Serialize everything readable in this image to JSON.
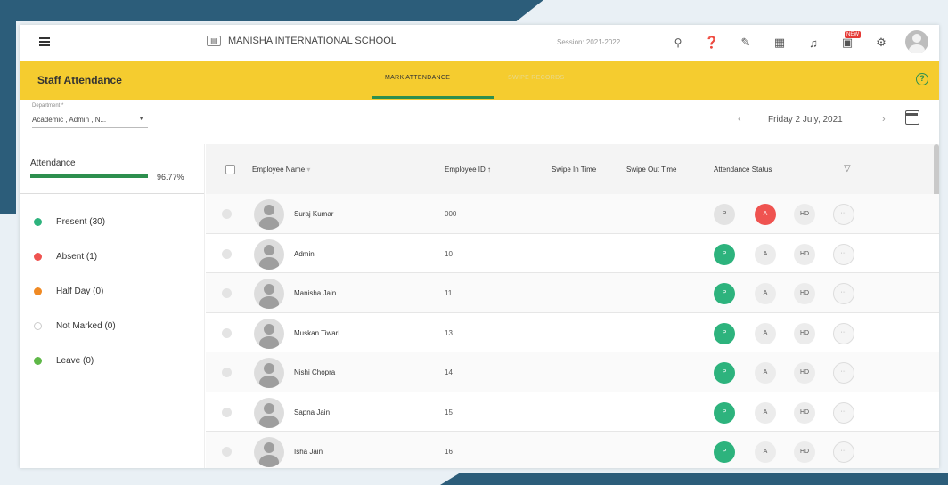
{
  "header": {
    "school_name": "MANISHA INTERNATIONAL SCHOOL",
    "session": "Session: 2021-2022",
    "new_badge": "NEW"
  },
  "page": {
    "title": "Staff Attendance",
    "tabs": [
      {
        "label": "MARK ATTENDANCE",
        "active": true
      },
      {
        "label": "SWIPE RECORDS",
        "active": false
      }
    ]
  },
  "filters": {
    "department_label": "Department *",
    "department_value": "Academic , Admin , N...",
    "date": "Friday 2 July, 2021"
  },
  "summary": {
    "attendance_label": "Attendance",
    "attendance_pct": "96.77%",
    "attendance_fraction": 0.9677,
    "legend": [
      {
        "label": "Present (30)",
        "color": "#2db37d"
      },
      {
        "label": "Absent (1)",
        "color": "#ef5350"
      },
      {
        "label": "Half Day (0)",
        "color": "#f08a24"
      },
      {
        "label": "Not Marked (0)",
        "color": "hollow"
      },
      {
        "label": "Leave (0)",
        "color": "#5fb848"
      }
    ]
  },
  "table": {
    "columns": {
      "name": "Employee Name",
      "id": "Employee ID",
      "swipe_in": "Swipe In Time",
      "swipe_out": "Swipe Out Time",
      "status": "Attendance Status"
    },
    "status_labels": {
      "present": "P",
      "absent": "A",
      "half_day": "HD",
      "more": "···"
    },
    "rows": [
      {
        "name": "Suraj Kumar",
        "id": "000",
        "status": "absent"
      },
      {
        "name": "Admin",
        "id": "10",
        "status": "present"
      },
      {
        "name": "Manisha Jain",
        "id": "11",
        "status": "present"
      },
      {
        "name": "Muskan Tiwari",
        "id": "13",
        "status": "present"
      },
      {
        "name": "Nishi Chopra",
        "id": "14",
        "status": "present"
      },
      {
        "name": "Sapna Jain",
        "id": "15",
        "status": "present"
      },
      {
        "name": "Isha Jain",
        "id": "16",
        "status": "present"
      }
    ]
  },
  "colors": {
    "brand_yellow": "#f5cc2f",
    "accent_green": "#2d8f4e",
    "present_green": "#2db37d",
    "absent_red": "#ef5350"
  }
}
